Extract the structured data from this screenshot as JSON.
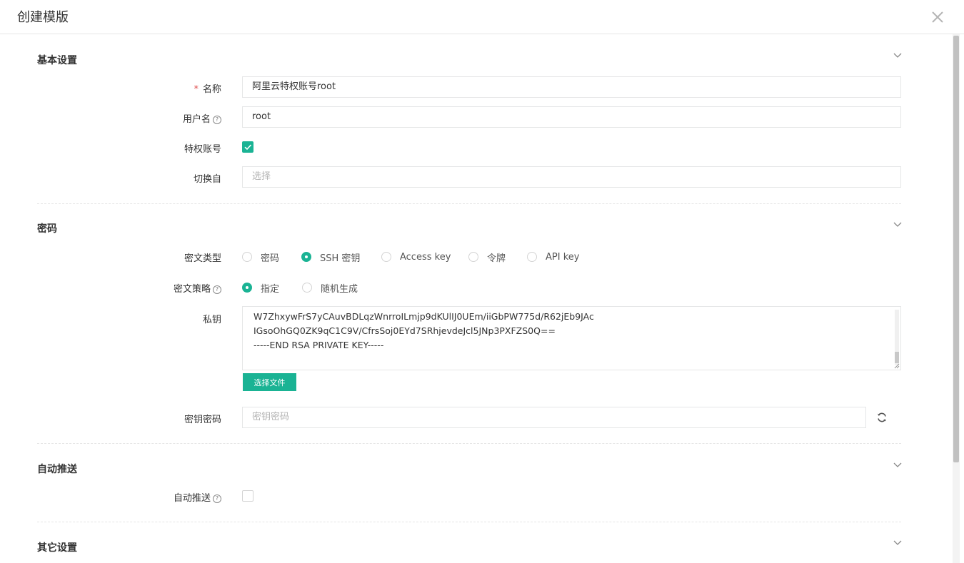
{
  "dialog": {
    "title": "创建模版"
  },
  "sections": {
    "basic": {
      "title": "基本设置"
    },
    "secret": {
      "title": "密码"
    },
    "autopush": {
      "title": "自动推送"
    },
    "other": {
      "title": "其它设置"
    }
  },
  "basic": {
    "name": {
      "label": "名称",
      "required_mark": "*",
      "value": "阿里云特权账号root"
    },
    "username": {
      "label": "用户名",
      "value": "root",
      "help": "?"
    },
    "privileged": {
      "label": "特权账号",
      "checked": true
    },
    "su_from": {
      "label": "切换自",
      "placeholder": "选择"
    }
  },
  "secret": {
    "type": {
      "label": "密文类型",
      "options": [
        "密码",
        "SSH 密钥",
        "Access key",
        "令牌",
        "API key"
      ],
      "selected": "SSH 密钥"
    },
    "strategy": {
      "label": "密文策略",
      "help": "?",
      "options": [
        "指定",
        "随机生成"
      ],
      "selected": "指定"
    },
    "private_key": {
      "label": "私钥",
      "lines": [
        "W7ZhxywFrS7yCAuvBDLqzWnrroILmjp9dKUlIJ0UEm/iiGbPW775d/R62jEb9JAc",
        "IGsoOhGQ0ZK9qC1C9V/CfrsSoj0EYd7SRhjevdeJcl5JNp3PXFZS0Q==",
        "-----END RSA PRIVATE KEY-----"
      ],
      "file_button": "选择文件"
    },
    "passphrase": {
      "label": "密钥密码",
      "placeholder": "密钥密码"
    }
  },
  "autopush": {
    "enabled": {
      "label": "自动推送",
      "help": "?",
      "checked": false
    }
  },
  "colors": {
    "accent": "#1ab394",
    "required": "#e05252"
  },
  "icons": {
    "close": "close-icon",
    "collapse": "chevron-down-icon",
    "refresh": "refresh-icon",
    "help": "question-circle-icon",
    "check": "check-icon"
  }
}
